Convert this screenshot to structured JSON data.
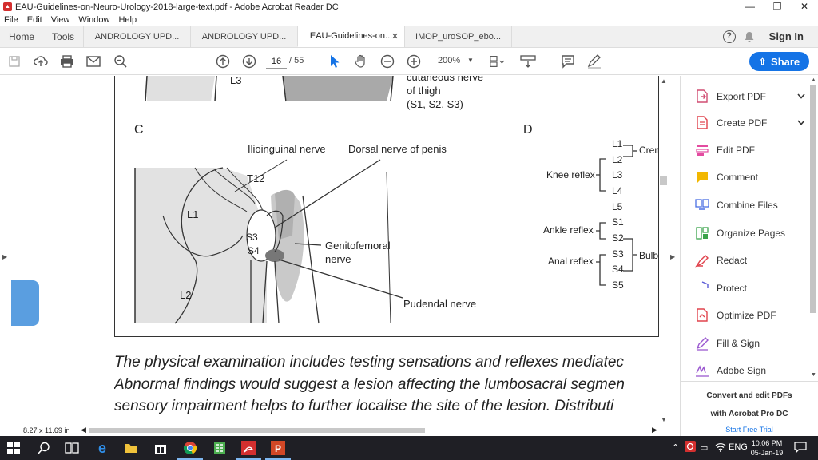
{
  "window": {
    "title": "EAU-Guidelines-on-Neuro-Urology-2018-large-text.pdf - Adobe Acrobat Reader DC",
    "minimize": "—",
    "maximize": "❐",
    "close": "✕"
  },
  "menu": [
    "File",
    "Edit",
    "View",
    "Window",
    "Help"
  ],
  "tabs": {
    "home": "Home",
    "tools": "Tools",
    "docs": [
      {
        "label": "ANDROLOGY UPD..."
      },
      {
        "label": "ANDROLOGY UPD..."
      },
      {
        "label": "EAU-Guidelines-on...",
        "active": true,
        "close": "✕"
      },
      {
        "label": "IMOP_uroSOP_ebo..."
      }
    ],
    "help": "?",
    "signin": "Sign In"
  },
  "toolbar": {
    "page_current": "16",
    "page_total": "/ 55",
    "zoom": "200%",
    "share": "Share"
  },
  "figure": {
    "top_label_l3": "L3",
    "top_cutaneous": "cutaneous nerve",
    "top_of_thigh": "of thigh",
    "top_segments": "(S1, S2, S3)",
    "letter_c": "C",
    "letter_d": "D",
    "ilioinguinal": "Ilioinguinal nerve",
    "dorsal": "Dorsal nerve of penis",
    "t12": "T12",
    "l1": "L1",
    "l2": "L2",
    "s3": "S3",
    "s4": "S4",
    "genitofemoral_1": "Genitofemoral",
    "genitofemoral_2": "nerve",
    "pudendal": "Pudendal nerve",
    "segments": [
      "L1",
      "L2",
      "L3",
      "L4",
      "L5",
      "S1",
      "S2",
      "S3",
      "S4",
      "S5"
    ],
    "knee_reflex": "Knee reflex",
    "ankle_reflex": "Ankle reflex",
    "anal_reflex": "Anal reflex",
    "crem": "Crem",
    "bulb": "Bulb"
  },
  "body_text": [
    "The physical examination includes testing sensations and reflexes mediatec",
    "Abnormal findings would suggest a lesion affecting the lumbosacral segmen",
    "sensory impairment helps to further localise the site of the lesion. Distributi"
  ],
  "status": {
    "page_size": "8.27 x 11.69 in"
  },
  "right_panel": {
    "items": [
      {
        "label": "Export PDF",
        "icon": "export-pdf-icon",
        "color": "#d14d72",
        "chevron": true
      },
      {
        "label": "Create PDF",
        "icon": "create-pdf-icon",
        "color": "#e0434d",
        "chevron": true
      },
      {
        "label": "Edit PDF",
        "icon": "edit-pdf-icon",
        "color": "#e34ba0"
      },
      {
        "label": "Comment",
        "icon": "comment-icon",
        "color": "#f2b700"
      },
      {
        "label": "Combine Files",
        "icon": "combine-files-icon",
        "color": "#4a6fe3"
      },
      {
        "label": "Organize Pages",
        "icon": "organize-pages-icon",
        "color": "#3aa34a"
      },
      {
        "label": "Redact",
        "icon": "redact-icon",
        "color": "#e0434d"
      },
      {
        "label": "Protect",
        "icon": "protect-icon",
        "color": "#5a5ad6"
      },
      {
        "label": "Optimize PDF",
        "icon": "optimize-pdf-icon",
        "color": "#e0434d"
      },
      {
        "label": "Fill & Sign",
        "icon": "fill-sign-icon",
        "color": "#9b59d0"
      },
      {
        "label": "Adobe Sign",
        "icon": "adobe-sign-icon",
        "color": "#9b59d0"
      }
    ],
    "promo_line1": "Convert and edit PDFs",
    "promo_line2": "with Acrobat Pro DC",
    "trial": "Start Free Trial"
  },
  "taskbar": {
    "lang": "ENG",
    "time": "10:06 PM",
    "date": "05-Jan-19"
  },
  "colors": {
    "accent": "#1473e6",
    "taskbar": "#1f1f25",
    "figure_gray": "#cfcfcf"
  }
}
